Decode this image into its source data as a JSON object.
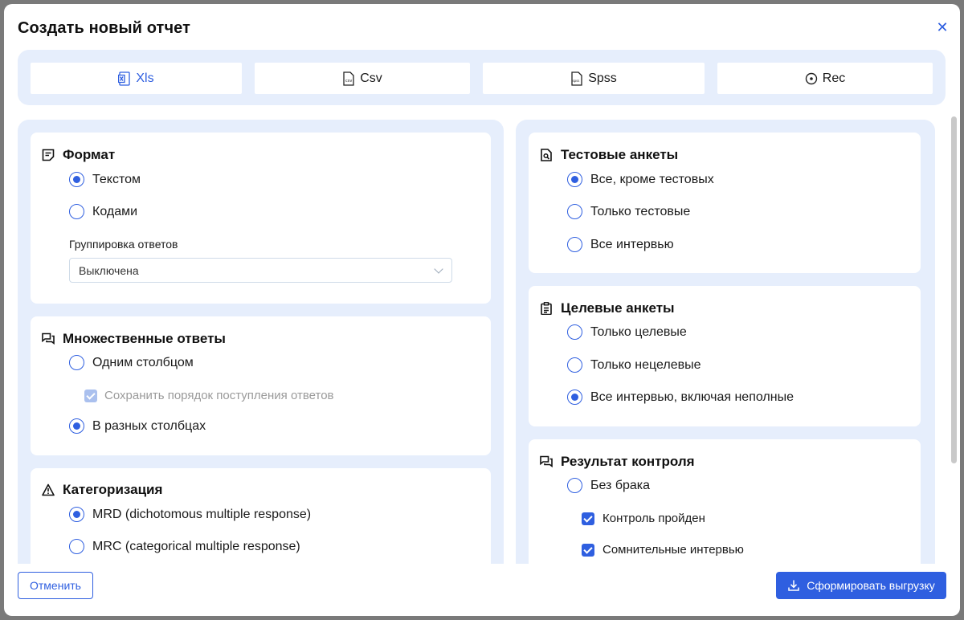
{
  "dialog": {
    "title": "Создать новый отчет",
    "close_icon": "close-icon"
  },
  "tabs": [
    {
      "label": "Xls",
      "icon": "excel-file-icon",
      "active": true
    },
    {
      "label": "Csv",
      "icon": "csv-file-icon",
      "active": false
    },
    {
      "label": "Spss",
      "icon": "spss-file-icon",
      "active": false
    },
    {
      "label": "Rec",
      "icon": "target-icon",
      "active": false
    }
  ],
  "format": {
    "title": "Формат",
    "options": [
      "Текстом",
      "Кодами"
    ],
    "selected": 0,
    "grouping_label": "Группировка ответов",
    "grouping_value": "Выключена"
  },
  "multiple": {
    "title": "Множественные ответы",
    "option_one_column": "Одним столбцом",
    "keep_order_label": "Сохранить порядок поступления ответов",
    "option_separate": "В разных столбцах",
    "selected": 1
  },
  "categorization": {
    "title": "Категоризация",
    "options": [
      "MRD (dichotomous multiple response)",
      "MRC (categorical multiple response)"
    ],
    "selected": 0
  },
  "test": {
    "title": "Тестовые анкеты",
    "options": [
      "Все, кроме тестовых",
      "Только тестовые",
      "Все интервью"
    ],
    "selected": 0
  },
  "target": {
    "title": "Целевые анкеты",
    "options": [
      "Только целевые",
      "Только нецелевые",
      "Все интервью, включая неполные"
    ],
    "selected": 2
  },
  "control": {
    "title": "Результат контроля",
    "option_no_defect": "Без брака",
    "checks": [
      "Контроль пройден",
      "Сомнительные интервью"
    ]
  },
  "footer": {
    "cancel": "Отменить",
    "submit": "Сформировать выгрузку"
  },
  "colors": {
    "accent": "#2f5fe0",
    "panel": "#e6eefc"
  }
}
